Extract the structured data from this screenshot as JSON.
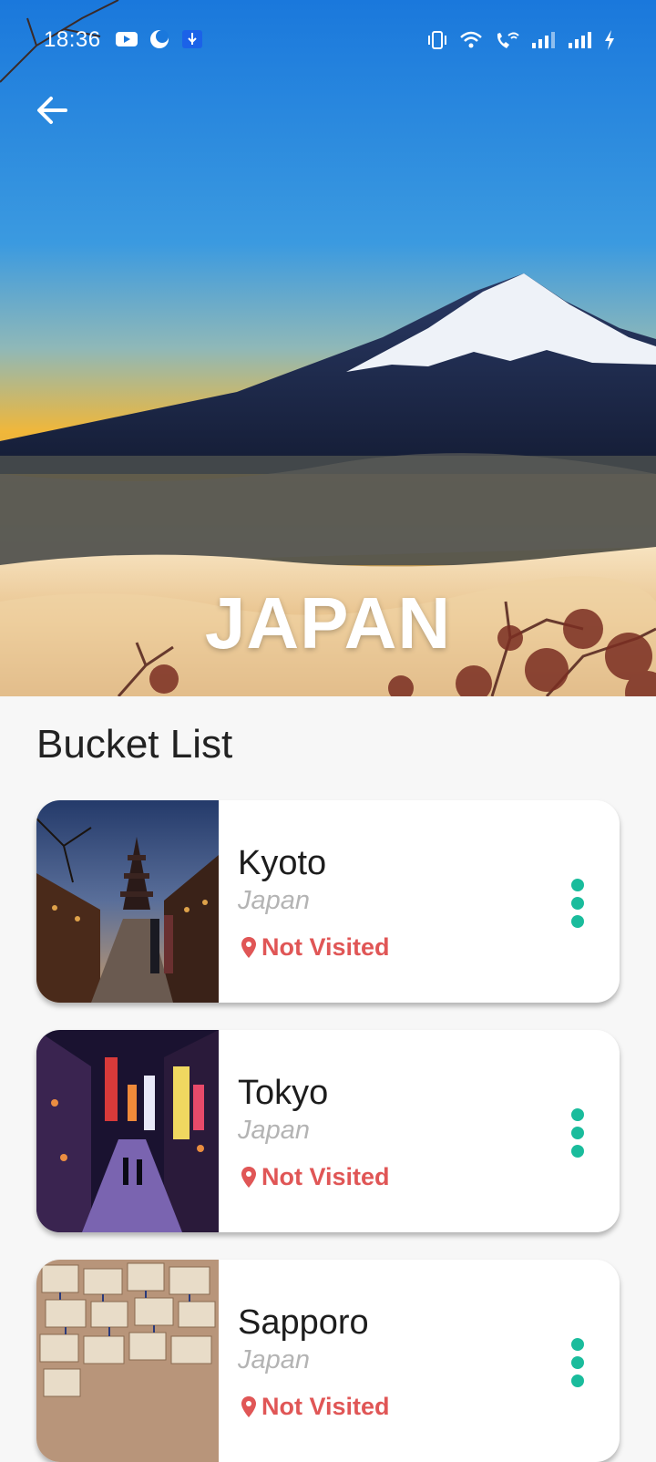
{
  "status_bar": {
    "time": "18:36",
    "left_icons": [
      "youtube-icon",
      "moon-icon",
      "usb-icon"
    ],
    "right_icons": [
      "vibrate-icon",
      "wifi-icon",
      "wifi-call-icon",
      "signal-icon",
      "signal-icon",
      "charging-icon"
    ]
  },
  "header": {
    "back_icon": "arrow-left-icon",
    "title": "JAPAN"
  },
  "section": {
    "title": "Bucket List"
  },
  "cards": [
    {
      "city": "Kyoto",
      "country": "Japan",
      "status": "Not Visited",
      "status_icon": "location-pin-icon",
      "menu_icon": "more-vertical-icon"
    },
    {
      "city": "Tokyo",
      "country": "Japan",
      "status": "Not Visited",
      "status_icon": "location-pin-icon",
      "menu_icon": "more-vertical-icon"
    },
    {
      "city": "Sapporo",
      "country": "Japan",
      "status": "Not Visited",
      "status_icon": "location-pin-icon",
      "menu_icon": "more-vertical-icon"
    }
  ],
  "colors": {
    "accent": "#1abc9c",
    "status_not_visited": "#e05656",
    "muted_text": "#b4b4b4"
  }
}
